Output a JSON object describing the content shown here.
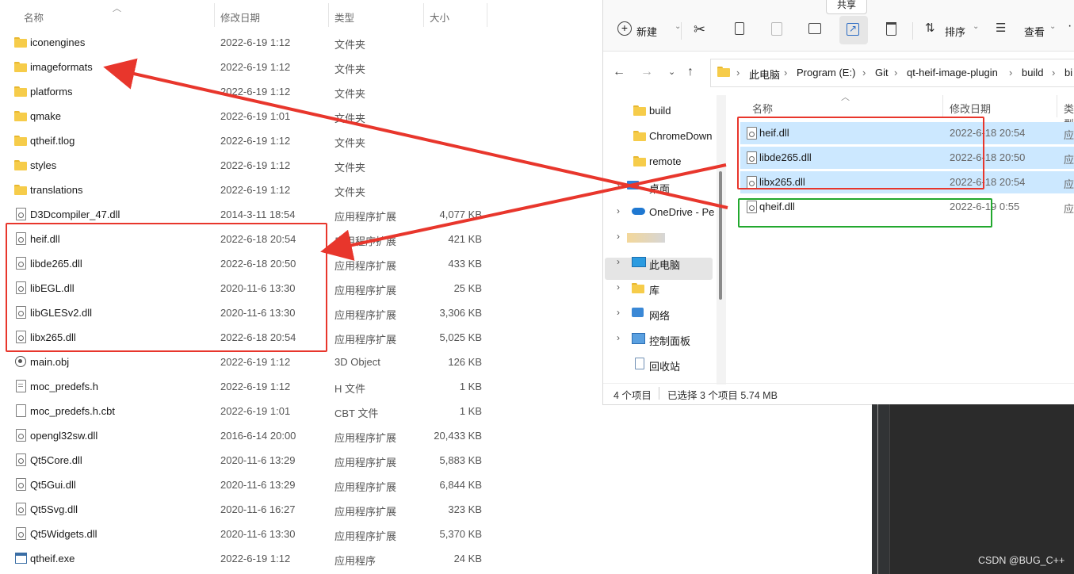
{
  "left_explorer": {
    "headers": {
      "name": "名称",
      "date": "修改日期",
      "type": "类型",
      "size": "大小"
    },
    "rows": [
      {
        "name": "iconengines",
        "date": "2022-6-19 1:12",
        "type": "文件夹",
        "size": "",
        "icon": "folder"
      },
      {
        "name": "imageformats",
        "date": "2022-6-19 1:12",
        "type": "文件夹",
        "size": "",
        "icon": "folder"
      },
      {
        "name": "platforms",
        "date": "2022-6-19 1:12",
        "type": "文件夹",
        "size": "",
        "icon": "folder"
      },
      {
        "name": "qmake",
        "date": "2022-6-19 1:01",
        "type": "文件夹",
        "size": "",
        "icon": "folder"
      },
      {
        "name": "qtheif.tlog",
        "date": "2022-6-19 1:12",
        "type": "文件夹",
        "size": "",
        "icon": "folder"
      },
      {
        "name": "styles",
        "date": "2022-6-19 1:12",
        "type": "文件夹",
        "size": "",
        "icon": "folder"
      },
      {
        "name": "translations",
        "date": "2022-6-19 1:12",
        "type": "文件夹",
        "size": "",
        "icon": "folder"
      },
      {
        "name": "D3Dcompiler_47.dll",
        "date": "2014-3-11 18:54",
        "type": "应用程序扩展",
        "size": "4,077 KB",
        "icon": "dll"
      },
      {
        "name": "heif.dll",
        "date": "2022-6-18 20:54",
        "type": "应用程序扩展",
        "size": "421 KB",
        "icon": "dll"
      },
      {
        "name": "libde265.dll",
        "date": "2022-6-18 20:50",
        "type": "应用程序扩展",
        "size": "433 KB",
        "icon": "dll"
      },
      {
        "name": "libEGL.dll",
        "date": "2020-11-6 13:30",
        "type": "应用程序扩展",
        "size": "25 KB",
        "icon": "dll"
      },
      {
        "name": "libGLESv2.dll",
        "date": "2020-11-6 13:30",
        "type": "应用程序扩展",
        "size": "3,306 KB",
        "icon": "dll"
      },
      {
        "name": "libx265.dll",
        "date": "2022-6-18 20:54",
        "type": "应用程序扩展",
        "size": "5,025 KB",
        "icon": "dll"
      },
      {
        "name": "main.obj",
        "date": "2022-6-19 1:12",
        "type": "3D Object",
        "size": "126 KB",
        "icon": "obj"
      },
      {
        "name": "moc_predefs.h",
        "date": "2022-6-19 1:12",
        "type": "H 文件",
        "size": "1 KB",
        "icon": "text"
      },
      {
        "name": "moc_predefs.h.cbt",
        "date": "2022-6-19 1:01",
        "type": "CBT 文件",
        "size": "1 KB",
        "icon": "blank"
      },
      {
        "name": "opengl32sw.dll",
        "date": "2016-6-14 20:00",
        "type": "应用程序扩展",
        "size": "20,433 KB",
        "icon": "dll"
      },
      {
        "name": "Qt5Core.dll",
        "date": "2020-11-6 13:29",
        "type": "应用程序扩展",
        "size": "5,883 KB",
        "icon": "dll"
      },
      {
        "name": "Qt5Gui.dll",
        "date": "2020-11-6 13:29",
        "type": "应用程序扩展",
        "size": "6,844 KB",
        "icon": "dll"
      },
      {
        "name": "Qt5Svg.dll",
        "date": "2020-11-6 16:27",
        "type": "应用程序扩展",
        "size": "323 KB",
        "icon": "dll"
      },
      {
        "name": "Qt5Widgets.dll",
        "date": "2020-11-6 13:30",
        "type": "应用程序扩展",
        "size": "5,370 KB",
        "icon": "dll"
      },
      {
        "name": "qtheif.exe",
        "date": "2022-6-19 1:12",
        "type": "应用程序",
        "size": "24 KB",
        "icon": "exe"
      }
    ]
  },
  "right_explorer": {
    "tooltip": "共享",
    "toolbar": {
      "new": "新建",
      "sort": "排序",
      "view": "查看"
    },
    "breadcrumb": [
      "此电脑",
      "Program (E:)",
      "Git",
      "qt-heif-image-plugin",
      "build",
      "bi"
    ],
    "nav": [
      "build",
      "ChromeDown",
      "remote",
      "桌面",
      "OneDrive - Pe",
      "",
      "此电脑",
      "库",
      "网络",
      "控制面板",
      "回收站"
    ],
    "headers": {
      "name": "名称",
      "date": "修改日期",
      "type": "类型"
    },
    "files": [
      {
        "name": "heif.dll",
        "date": "2022-6-18 20:54",
        "type": "应",
        "selected": true
      },
      {
        "name": "libde265.dll",
        "date": "2022-6-18 20:50",
        "type": "应",
        "selected": true
      },
      {
        "name": "libx265.dll",
        "date": "2022-6-18 20:54",
        "type": "应",
        "selected": true
      },
      {
        "name": "qheif.dll",
        "date": "2022-6-19 0:55",
        "type": "应",
        "selected": false
      }
    ],
    "status": {
      "count": "4 个项目",
      "selected": "已选择 3 个项目  5.74 MB"
    }
  },
  "watermark": "CSDN @BUG_C++",
  "colors": {
    "annotation_red": "#e8362c",
    "annotation_green": "#22a82e",
    "selection": "#cce8ff"
  }
}
